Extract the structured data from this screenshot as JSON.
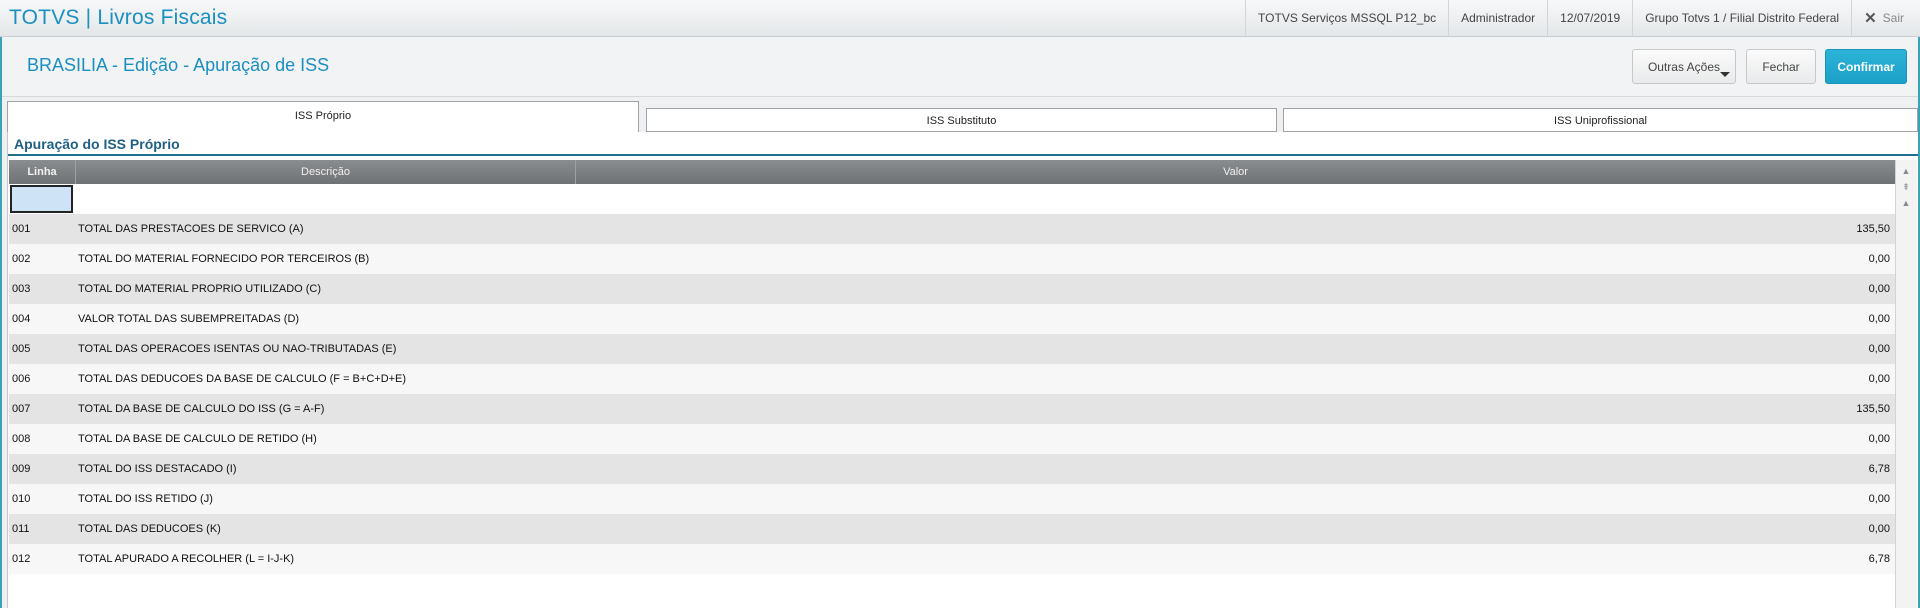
{
  "topbar": {
    "title": "TOTVS | Livros Fiscais",
    "environment": "TOTVS Serviços MSSQL P12_bc",
    "user": "Administrador",
    "date": "12/07/2019",
    "company": "Grupo Totvs 1 / Filial Distrito Federal",
    "exit_label": "Sair",
    "exit_icon": "close-icon"
  },
  "header": {
    "title": "BRASILIA -  Edição - Apuração de ISS",
    "buttons": {
      "outras": "Outras Ações",
      "fechar": "Fechar",
      "confirmar": "Confirmar"
    },
    "accent_color": "#1a8fc0",
    "confirm_color": "#1ba0c8"
  },
  "tabs": [
    {
      "label": "ISS Próprio",
      "active": true
    },
    {
      "label": "ISS Substituto",
      "active": false
    },
    {
      "label": "ISS Uniprofissional",
      "active": false
    }
  ],
  "section": {
    "title": "Apuração do ISS Próprio"
  },
  "grid": {
    "columns": {
      "linha": "Linha",
      "descricao": "Descrição",
      "valor": "Valor"
    },
    "rows": [
      {
        "linha": "001",
        "descricao": "TOTAL DAS PRESTACOES DE SERVICO (A)",
        "valor": "135,50"
      },
      {
        "linha": "002",
        "descricao": "TOTAL DO MATERIAL FORNECIDO POR TERCEIROS (B)",
        "valor": "0,00"
      },
      {
        "linha": "003",
        "descricao": "TOTAL DO MATERIAL PROPRIO UTILIZADO (C)",
        "valor": "0,00"
      },
      {
        "linha": "004",
        "descricao": "VALOR TOTAL DAS SUBEMPREITADAS (D)",
        "valor": "0,00"
      },
      {
        "linha": "005",
        "descricao": "TOTAL DAS OPERACOES ISENTAS OU NAO-TRIBUTADAS (E)",
        "valor": "0,00"
      },
      {
        "linha": "006",
        "descricao": "TOTAL DAS DEDUCOES DA BASE DE CALCULO (F = B+C+D+E)",
        "valor": "0,00"
      },
      {
        "linha": "007",
        "descricao": "TOTAL DA BASE DE CALCULO DO ISS (G = A-F)",
        "valor": "135,50"
      },
      {
        "linha": "008",
        "descricao": "TOTAL DA BASE DE CALCULO DE RETIDO (H)",
        "valor": "0,00"
      },
      {
        "linha": "009",
        "descricao": "TOTAL DO ISS DESTACADO (I)",
        "valor": "6,78"
      },
      {
        "linha": "010",
        "descricao": "TOTAL DO ISS RETIDO (J)",
        "valor": "0,00"
      },
      {
        "linha": "011",
        "descricao": "TOTAL DAS DEDUCOES (K)",
        "valor": "0,00"
      },
      {
        "linha": "012",
        "descricao": "TOTAL APURADO A RECOLHER (L = I-J-K)",
        "valor": "6,78"
      }
    ]
  },
  "scrollbar": {
    "icons": [
      "scroll-top-icon",
      "scroll-page-up-icon",
      "scroll-up-icon"
    ]
  }
}
